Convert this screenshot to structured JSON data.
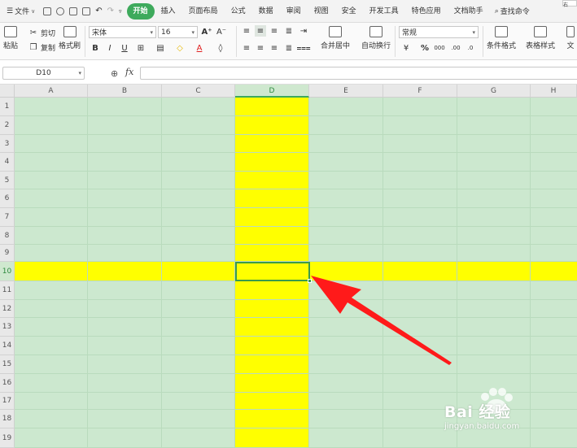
{
  "menubar": {
    "file_label": "文件",
    "tabs": [
      "开始",
      "插入",
      "页面布局",
      "公式",
      "数据",
      "审阅",
      "视图",
      "安全",
      "开发工具",
      "特色应用",
      "文档助手"
    ],
    "search_label": "查找命令",
    "edge_tab_label": "右"
  },
  "ribbon": {
    "paste_label": "粘贴",
    "cut_label": "剪切",
    "copy_label": "复制",
    "format_painter_label": "格式刷",
    "font_name": "宋体",
    "font_size": "16",
    "merge_center_label": "合并居中",
    "wrap_text_label": "自动换行",
    "number_format": "常规",
    "conditional_format_label": "条件格式",
    "table_style_label": "表格样式",
    "far_right_label": "文"
  },
  "formula_bar": {
    "cell_ref": "D10",
    "fx_label": "fx",
    "content": ""
  },
  "sheet": {
    "columns": [
      "A",
      "B",
      "C",
      "D",
      "E",
      "F",
      "G",
      "H"
    ],
    "rows": [
      "1",
      "2",
      "3",
      "4",
      "5",
      "6",
      "7",
      "8",
      "9",
      "10",
      "11",
      "12",
      "13",
      "14",
      "15",
      "16",
      "17",
      "18",
      "19"
    ],
    "selected_column": "D",
    "selected_row": "10",
    "highlight_color": "#ffff00",
    "grid_background": "#cce8cf",
    "accent": "#3eaa5c"
  },
  "annotation": {
    "arrow_color": "#ff1a1a"
  },
  "watermark": {
    "brand": "Bai 经验",
    "url": "jingyan.baidu.com"
  }
}
